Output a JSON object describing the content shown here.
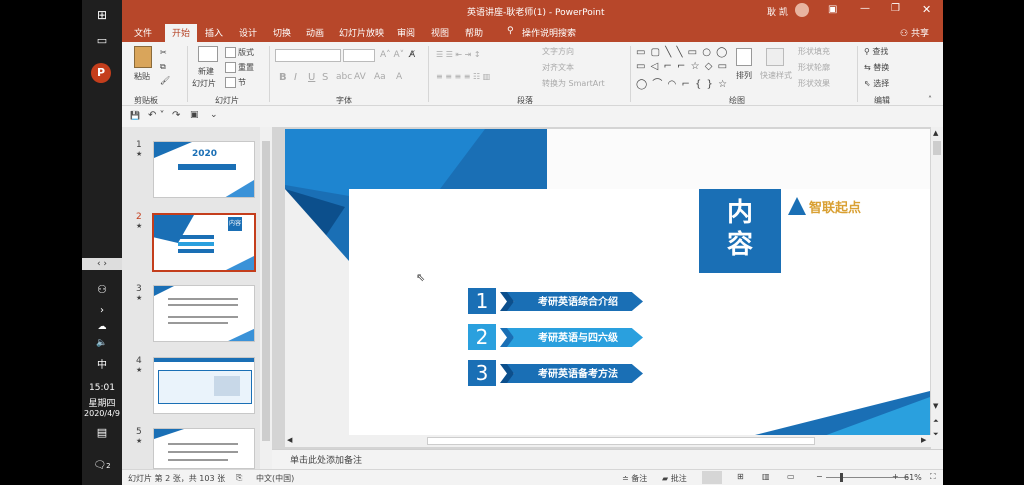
{
  "window": {
    "title": "英语讲座-耿老师(1) - PowerPoint",
    "user": "耿 凯",
    "share": "共享"
  },
  "tabs": [
    "文件",
    "开始",
    "插入",
    "设计",
    "切换",
    "动画",
    "幻灯片放映",
    "审阅",
    "视图",
    "帮助",
    "操作说明搜索"
  ],
  "ribbon": {
    "clipboard": {
      "paste": "粘贴",
      "label": "剪贴板"
    },
    "slides": {
      "new_slide": "新建",
      "new_slide2": "幻灯片",
      "layout": "版式",
      "reset": "重置",
      "section": "节",
      "label": "幻灯片"
    },
    "font": {
      "bold": "B",
      "italic": "I",
      "underline": "U",
      "strike": "S",
      "spacing": "AV",
      "case": "Aa",
      "color": "A",
      "label": "字体"
    },
    "paragraph": {
      "text_direction": "文字方向",
      "align_text": "对齐文本",
      "smartart": "转换为 SmartArt",
      "label": "段落"
    },
    "drawing": {
      "arrange": "排列",
      "quick_styles": "快速样式",
      "fill": "形状填充",
      "outline": "形状轮廓",
      "effects": "形状效果",
      "label": "绘图"
    },
    "editing": {
      "find": "查找",
      "replace": "替换",
      "select": "选择",
      "label": "编辑"
    }
  },
  "thumbnails": [
    {
      "num": "1",
      "star": "★",
      "year": "2020"
    },
    {
      "num": "2",
      "star": "★",
      "title": "内容"
    },
    {
      "num": "3",
      "star": "★"
    },
    {
      "num": "4",
      "star": "★"
    },
    {
      "num": "5",
      "star": "★"
    }
  ],
  "slide": {
    "title_line1": "内",
    "title_line2": "容",
    "logo": "智联起点",
    "items": [
      {
        "num": "1",
        "text": "考研英语综合介绍"
      },
      {
        "num": "2",
        "text": "考研英语与四六级"
      },
      {
        "num": "3",
        "text": "考研英语备考方法"
      }
    ]
  },
  "notes_placeholder": "单击此处添加备注",
  "status": {
    "slide_info": "幻灯片 第 2 张，共 103 张",
    "language": "中文(中国)",
    "notes": "备注",
    "comments": "批注",
    "zoom": "61%"
  },
  "taskbar": {
    "time": "15:01",
    "weekday": "星期四",
    "date": "2020/4/9",
    "ime": "中",
    "notif": "2"
  },
  "colors": {
    "accent": "#b7472a",
    "slide_blue": "#1a6fb5",
    "slide_dark": "#0c4f8c"
  }
}
